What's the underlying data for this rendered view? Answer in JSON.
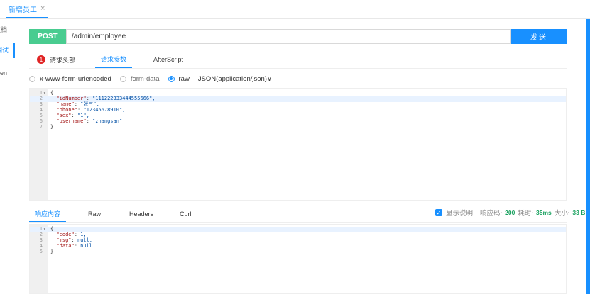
{
  "tabs": [
    {
      "label": "新增员工",
      "close": "×"
    }
  ],
  "sidebar": {
    "items": [
      {
        "label": "文档"
      },
      {
        "label": "调试"
      },
      {
        "label": "Open"
      }
    ]
  },
  "request": {
    "method": "POST",
    "url": "/admin/employee",
    "send_label": "发送",
    "tabs": [
      {
        "label": "请求头部",
        "badge": "1"
      },
      {
        "label": "请求参数"
      },
      {
        "label": "AfterScript"
      }
    ],
    "body_types": [
      "x-www-form-urlencoded",
      "form-data",
      "raw"
    ],
    "selected_body_type": "raw",
    "content_type": "JSON(application/json)∨",
    "body_lines": [
      {
        "num": "1",
        "fold": "▾",
        "text": "{"
      },
      {
        "num": "2",
        "key": "\"idNumber\"",
        "value": "\"111222333444555666\","
      },
      {
        "num": "3",
        "key": "\"name\"",
        "value": "\"张三\","
      },
      {
        "num": "4",
        "key": "\"phone\"",
        "value": "\"12345678910\","
      },
      {
        "num": "5",
        "key": "\"sex\"",
        "value": "\"1\","
      },
      {
        "num": "6",
        "key": "\"username\"",
        "value": "\"zhangsan\""
      },
      {
        "num": "7",
        "text": "}"
      }
    ]
  },
  "response": {
    "tabs": [
      {
        "label": "响应内容"
      },
      {
        "label": "Raw"
      },
      {
        "label": "Headers"
      },
      {
        "label": "Curl"
      }
    ],
    "show_desc_label": "显示说明",
    "status_label": "响应码:",
    "status_value": "200",
    "time_label": "耗时:",
    "time_value": "35ms",
    "size_label": "大小:",
    "size_value": "33 B",
    "body_lines": [
      {
        "num": "1",
        "fold": "▾",
        "text": "{"
      },
      {
        "num": "2",
        "key": "\"code\"",
        "value": "1,"
      },
      {
        "num": "3",
        "key": "\"msg\"",
        "value": "null,"
      },
      {
        "num": "4",
        "key": "\"data\"",
        "value": "null"
      },
      {
        "num": "5",
        "text": "}"
      }
    ]
  },
  "colors": {
    "accent": "#1890ff",
    "post": "#49cc90",
    "badge": "#e02424",
    "ok": "#19a15f"
  }
}
